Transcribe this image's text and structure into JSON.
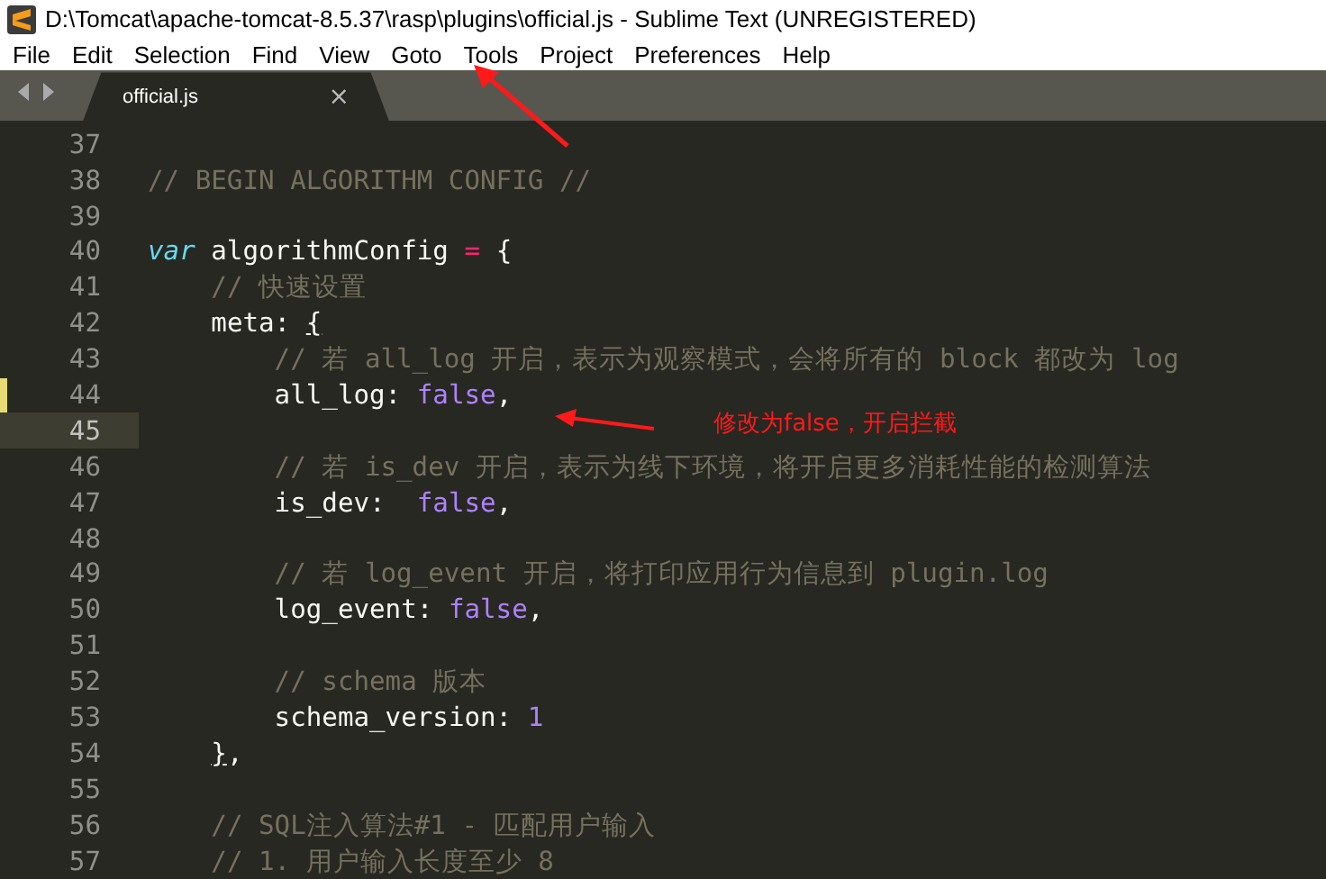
{
  "window": {
    "title": "D:\\Tomcat\\apache-tomcat-8.5.37\\rasp\\plugins\\official.js - Sublime Text (UNREGISTERED)"
  },
  "menu": [
    "File",
    "Edit",
    "Selection",
    "Find",
    "View",
    "Goto",
    "Tools",
    "Project",
    "Preferences",
    "Help"
  ],
  "tabs": [
    {
      "label": "official.js",
      "selected": true,
      "close": "×"
    }
  ],
  "editor": {
    "lines": [
      {
        "number": "37",
        "current": false,
        "modified": false
      },
      {
        "number": "38",
        "current": false,
        "modified": false,
        "tokens": [
          {
            "kind": "comment",
            "text": "// BEGIN ALGORITHM CONFIG //"
          }
        ]
      },
      {
        "number": "39",
        "current": false,
        "modified": false
      },
      {
        "number": "40",
        "current": false,
        "modified": false,
        "tokens": [
          {
            "kind": "keyword",
            "text": "var"
          },
          {
            "kind": "plain",
            "text": " algorithmConfig "
          },
          {
            "kind": "operator",
            "text": "="
          },
          {
            "kind": "plain",
            "text": " {"
          }
        ]
      },
      {
        "number": "41",
        "current": false,
        "modified": false,
        "tokens": [
          {
            "kind": "comment",
            "text": "    // 快速设置"
          }
        ]
      },
      {
        "number": "42",
        "current": false,
        "modified": false,
        "tokens": [
          {
            "kind": "plain",
            "text": "    meta: "
          },
          {
            "kind": "bracket",
            "text": "{"
          }
        ]
      },
      {
        "number": "43",
        "current": false,
        "modified": false,
        "tokens": [
          {
            "kind": "comment",
            "text": "        // 若 all_log 开启，表示为观察模式，会将所有的 block 都改为 log"
          }
        ]
      },
      {
        "number": "44",
        "current": false,
        "modified": true,
        "tokens": [
          {
            "kind": "plain",
            "text": "        all_log: "
          },
          {
            "kind": "constant",
            "text": "false"
          },
          {
            "kind": "plain",
            "text": ","
          }
        ]
      },
      {
        "number": "45",
        "current": true,
        "modified": false
      },
      {
        "number": "46",
        "current": false,
        "modified": false,
        "tokens": [
          {
            "kind": "comment",
            "text": "        // 若 is_dev 开启，表示为线下环境，将开启更多消耗性能的检测算法"
          }
        ]
      },
      {
        "number": "47",
        "current": false,
        "modified": false,
        "tokens": [
          {
            "kind": "plain",
            "text": "        is_dev:  "
          },
          {
            "kind": "constant",
            "text": "false"
          },
          {
            "kind": "plain",
            "text": ","
          }
        ]
      },
      {
        "number": "48",
        "current": false,
        "modified": false
      },
      {
        "number": "49",
        "current": false,
        "modified": false,
        "tokens": [
          {
            "kind": "comment",
            "text": "        // 若 log_event 开启，将打印应用行为信息到 plugin.log"
          }
        ]
      },
      {
        "number": "50",
        "current": false,
        "modified": false,
        "tokens": [
          {
            "kind": "plain",
            "text": "        log_event: "
          },
          {
            "kind": "constant",
            "text": "false"
          },
          {
            "kind": "plain",
            "text": ","
          }
        ]
      },
      {
        "number": "51",
        "current": false,
        "modified": false
      },
      {
        "number": "52",
        "current": false,
        "modified": false,
        "tokens": [
          {
            "kind": "comment",
            "text": "        // schema 版本"
          }
        ]
      },
      {
        "number": "53",
        "current": false,
        "modified": false,
        "tokens": [
          {
            "kind": "plain",
            "text": "        schema_version: "
          },
          {
            "kind": "constant",
            "text": "1"
          }
        ]
      },
      {
        "number": "54",
        "current": false,
        "modified": false,
        "tokens": [
          {
            "kind": "bracket",
            "text": "    }"
          },
          {
            "kind": "plain",
            "text": ","
          }
        ]
      },
      {
        "number": "55",
        "current": false,
        "modified": false
      },
      {
        "number": "56",
        "current": false,
        "modified": false,
        "tokens": [
          {
            "kind": "comment",
            "text": "    // SQL注入算法#1 - 匹配用户输入"
          }
        ]
      },
      {
        "number": "57",
        "current": false,
        "modified": false,
        "tokens": [
          {
            "kind": "comment",
            "text": "    // 1. 用户输入长度至少 8"
          }
        ]
      }
    ]
  },
  "annotation": {
    "text": "修改为false，开启拦截"
  }
}
